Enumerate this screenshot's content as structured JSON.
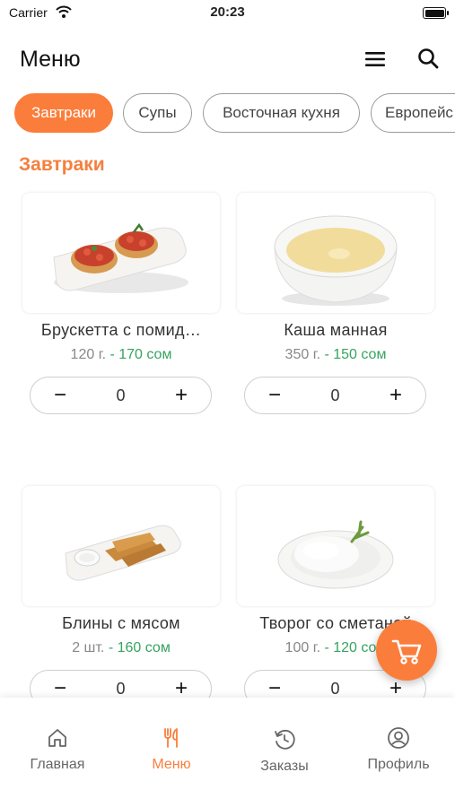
{
  "status_bar": {
    "carrier": "Carrier",
    "time": "20:23"
  },
  "header": {
    "title": "Меню",
    "menu_icon": "hamburger-menu-icon",
    "search_icon": "search-icon"
  },
  "categories": [
    {
      "label": "Завтраки",
      "active": true
    },
    {
      "label": "Супы",
      "active": false
    },
    {
      "label": "Восточная кухня",
      "active": false
    },
    {
      "label": "Европейс",
      "active": false
    }
  ],
  "section_title": "Завтраки",
  "products": [
    {
      "name": "Брускетта с помид…",
      "weight": "120 г.",
      "price": " - 170 сом",
      "qty": "0"
    },
    {
      "name": "Каша манная",
      "weight": "350 г.",
      "price": " - 150 сом",
      "qty": "0"
    },
    {
      "name": "Блины с мясом",
      "weight": "2 шт.",
      "price": " - 160 сом",
      "qty": "0"
    },
    {
      "name": "Творог со сметаной",
      "weight": "100 г.",
      "price": " - 120 сом",
      "qty": "0"
    }
  ],
  "stepper": {
    "minus": "−",
    "plus": "+"
  },
  "tabs": [
    {
      "label": "Главная",
      "icon": "home-icon"
    },
    {
      "label": "Меню",
      "icon": "fork-knife-icon"
    },
    {
      "label": "Заказы",
      "icon": "history-icon"
    },
    {
      "label": "Профиль",
      "icon": "profile-icon"
    }
  ],
  "colors": {
    "accent": "#fb7d3b",
    "price_green": "#36a35f",
    "section": "#f4803e"
  }
}
